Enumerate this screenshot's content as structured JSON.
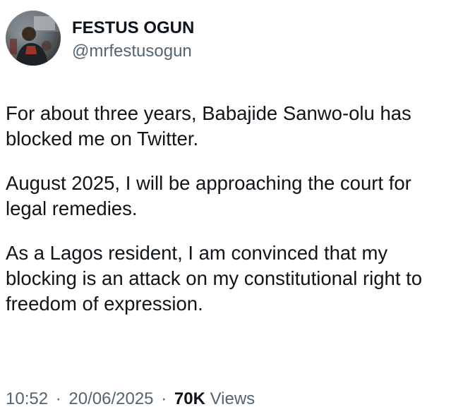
{
  "author": {
    "display_name": "FESTUS OGUN",
    "handle": "@mrfestusogun",
    "avatar_icon": "profile-photo"
  },
  "tweet": {
    "paragraphs": [
      [
        "For about three years, Babajide Sanwo-olu has",
        "blocked me on Twitter."
      ],
      [
        "August 2025, I will be approaching the court for",
        "legal remedies."
      ],
      [
        "As a Lagos resident, I am convinced that my",
        "blocking is an attack on my constitutional right to",
        "freedom of expression."
      ]
    ]
  },
  "meta": {
    "time": "10:52",
    "separator": "·",
    "date": "20/06/2025",
    "views_count": "70K",
    "views_label": "Views"
  },
  "colors": {
    "text_primary": "#0f1419",
    "text_secondary": "#536471",
    "background": "#ffffff"
  }
}
